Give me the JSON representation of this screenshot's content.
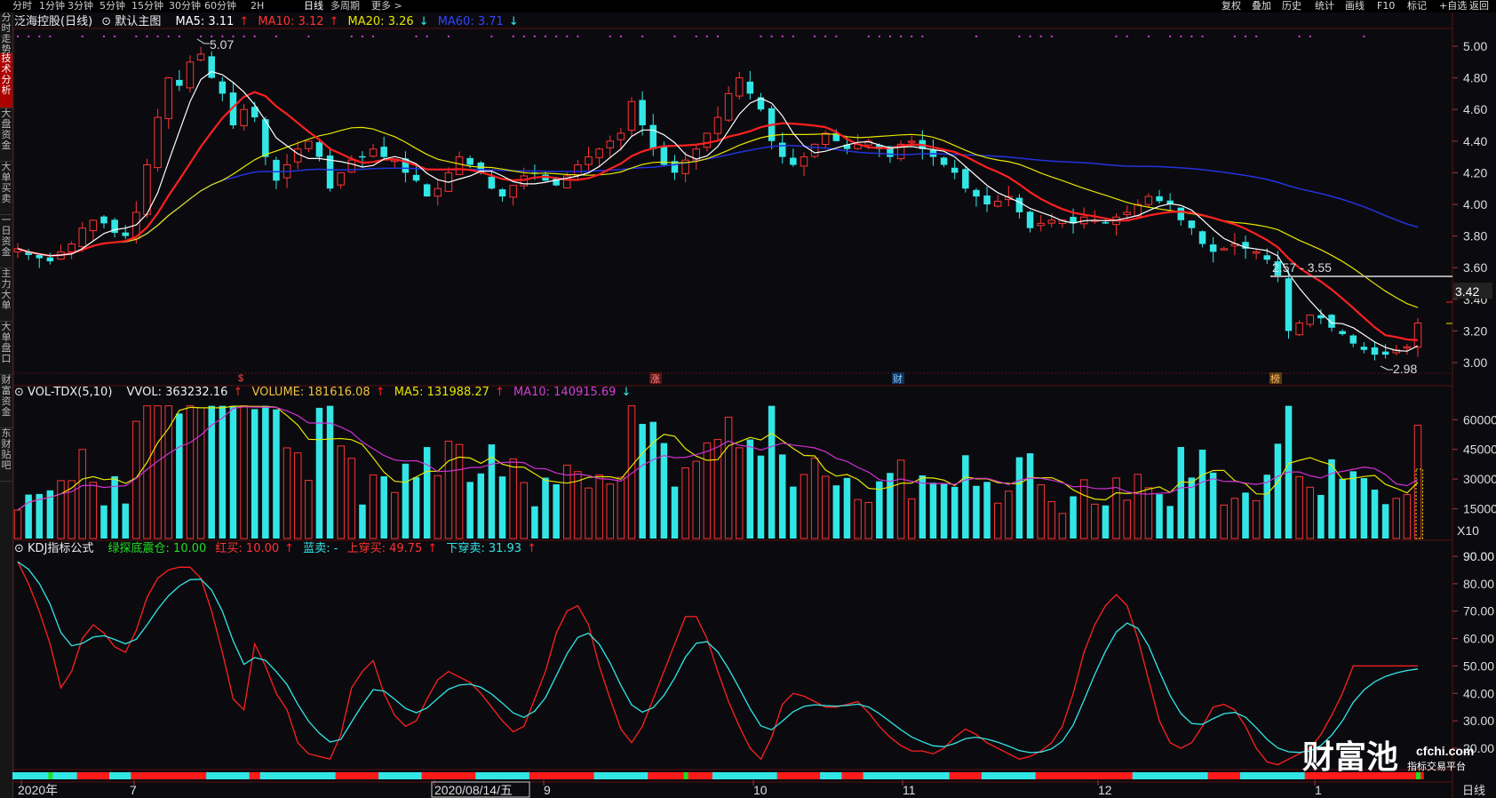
{
  "toolbar": {
    "periods": [
      "分时",
      "1分钟",
      "3分钟",
      "5分钟",
      "15分钟",
      "30分钟",
      "60分钟",
      "2H",
      "日线",
      "多周期",
      "更多 >"
    ],
    "active": "日线",
    "right": [
      "复权",
      "叠加",
      "历史",
      "统计",
      "画线",
      "F10",
      "标记",
      "+自选",
      "返回"
    ]
  },
  "sidebar": [
    "分时走势",
    "技术分析",
    "大盘资金",
    "大单买卖",
    "一日资金",
    "主力大单",
    "大单盘口",
    "财富资金",
    "东财贴吧"
  ],
  "sidebar_active": "技术分析",
  "main_header": {
    "stock": "泛海控股(日线)",
    "template": "默认主图",
    "ma5": "MA5: 3.11",
    "ma10": "MA10: 3.12",
    "ma20": "MA20: 3.26",
    "ma60": "MA60: 3.71"
  },
  "vol_header": {
    "name": "VOL-TDX(5,10)",
    "vvol": "VVOL: 363232.16",
    "volume": "VOLUME: 181616.08",
    "ma5": "MA5: 131988.27",
    "ma10": "MA10: 140915.69"
  },
  "kdj_header": {
    "name": "KDJ指标公式",
    "green": "绿探底震仓: 10.00",
    "red": "红买: 10.00",
    "blue": "蓝卖: -",
    "up": "上穿买: 49.75",
    "down": "下穿卖: 31.93"
  },
  "annotations": {
    "high": "5.07",
    "low": "2.98",
    "range": "2.57 - 3.55",
    "current_price": "3.42",
    "vol_unit": "X10",
    "period_label": "日线"
  },
  "date_axis": {
    "labels": [
      "2020年",
      "7",
      "2020/08/14/五",
      "9",
      "10",
      "11",
      "12",
      "1"
    ]
  },
  "event_markers": [
    "$",
    "涨",
    "财",
    "榜"
  ],
  "colors": {
    "up": "#ff3333",
    "down": "#33e6e6",
    "ma5": "#ffffff",
    "ma10": "#ff2020",
    "ma20": "#e6e600",
    "ma60": "#2233dd",
    "vol_ma5": "#e6e600",
    "vol_ma10": "#d030d0",
    "kdj_k": "#ff2020",
    "kdj_d": "#33e6e6"
  },
  "watermark": {
    "logo": "财富池",
    "site": "cfchi.com",
    "slogan": "指标交易平台"
  },
  "chart_data": [
    {
      "type": "candlestick",
      "title": "泛海控股(日线)",
      "ylim": [
        2.9,
        5.1
      ],
      "y_ticks": [
        3.0,
        3.2,
        3.4,
        3.6,
        3.8,
        4.0,
        4.2,
        4.4,
        4.6,
        4.8,
        5.0
      ],
      "close_anchors": [
        3.72,
        3.68,
        3.66,
        3.64,
        3.7,
        3.75,
        3.85,
        3.9,
        3.88,
        3.82,
        3.8,
        3.95,
        4.25,
        4.55,
        4.8,
        4.75,
        4.9,
        4.95,
        4.8,
        4.7,
        4.5,
        4.6,
        4.55,
        4.3,
        4.15,
        4.25,
        4.35,
        4.4,
        4.3,
        4.1,
        4.2,
        4.28,
        4.3,
        4.35,
        4.3,
        4.28,
        4.2,
        4.15,
        4.05,
        4.1,
        4.2,
        4.3,
        4.25,
        4.2,
        4.1,
        4.05,
        4.12,
        4.18,
        4.2,
        4.15,
        4.12,
        4.18,
        4.25,
        4.3,
        4.35,
        4.4,
        4.45,
        4.65,
        4.5,
        4.35,
        4.25,
        4.2,
        4.28,
        4.35,
        4.45,
        4.55,
        4.7,
        4.8,
        4.7,
        4.6,
        4.4,
        4.3,
        4.25,
        4.3,
        4.38,
        4.45,
        4.4,
        4.35,
        4.38,
        4.4,
        4.35,
        4.3,
        4.38,
        4.4,
        4.35,
        4.3,
        4.25,
        4.2,
        4.1,
        4.05,
        4.0,
        4.02,
        4.05,
        3.95,
        3.85,
        3.88,
        3.9,
        3.9,
        3.88,
        3.92,
        3.9,
        3.88,
        3.92,
        3.95,
        4.0,
        4.05,
        4.02,
        4.0,
        3.9,
        3.85,
        3.75,
        3.7,
        3.72,
        3.75,
        3.72,
        3.7,
        3.65,
        3.55,
        3.2,
        3.25,
        3.3,
        3.28,
        3.22,
        3.18,
        3.12,
        3.08,
        3.05,
        3.05,
        3.08,
        3.1,
        3.25
      ]
    },
    {
      "type": "bar",
      "title": "VOL-TDX(5,10)",
      "ylim": [
        0,
        70000
      ],
      "y_ticks": [
        15000,
        30000,
        45000,
        60000
      ],
      "unit": "X10",
      "series_names": [
        "MA5",
        "MA10"
      ]
    },
    {
      "type": "line",
      "title": "KDJ指标公式",
      "ylim": [
        10,
        95
      ],
      "y_ticks": [
        20,
        30,
        40,
        50,
        60,
        70,
        80,
        90
      ],
      "k_anchors": [
        88,
        80,
        70,
        58,
        42,
        48,
        60,
        65,
        62,
        57,
        55,
        63,
        75,
        82,
        85,
        86,
        86,
        82,
        70,
        55,
        38,
        34,
        58,
        50,
        40,
        34,
        22,
        18,
        17,
        16,
        25,
        42,
        48,
        52,
        40,
        32,
        28,
        30,
        38,
        45,
        48,
        46,
        44,
        40,
        35,
        30,
        26,
        28,
        38,
        48,
        62,
        70,
        72,
        65,
        50,
        38,
        27,
        22,
        28,
        38,
        48,
        58,
        68,
        68,
        60,
        48,
        37,
        28,
        20,
        16,
        24,
        36,
        40,
        39,
        37,
        35,
        35,
        36,
        37,
        33,
        28,
        24,
        21,
        19,
        19,
        18,
        20,
        24,
        27,
        25,
        22,
        20,
        18,
        16,
        17,
        19,
        22,
        28,
        40,
        55,
        65,
        72,
        76,
        72,
        60,
        45,
        30,
        22,
        20,
        22,
        28,
        35,
        36,
        34,
        28,
        20,
        15,
        14,
        16,
        18,
        20,
        25,
        32,
        40,
        50
      ]
    }
  ]
}
